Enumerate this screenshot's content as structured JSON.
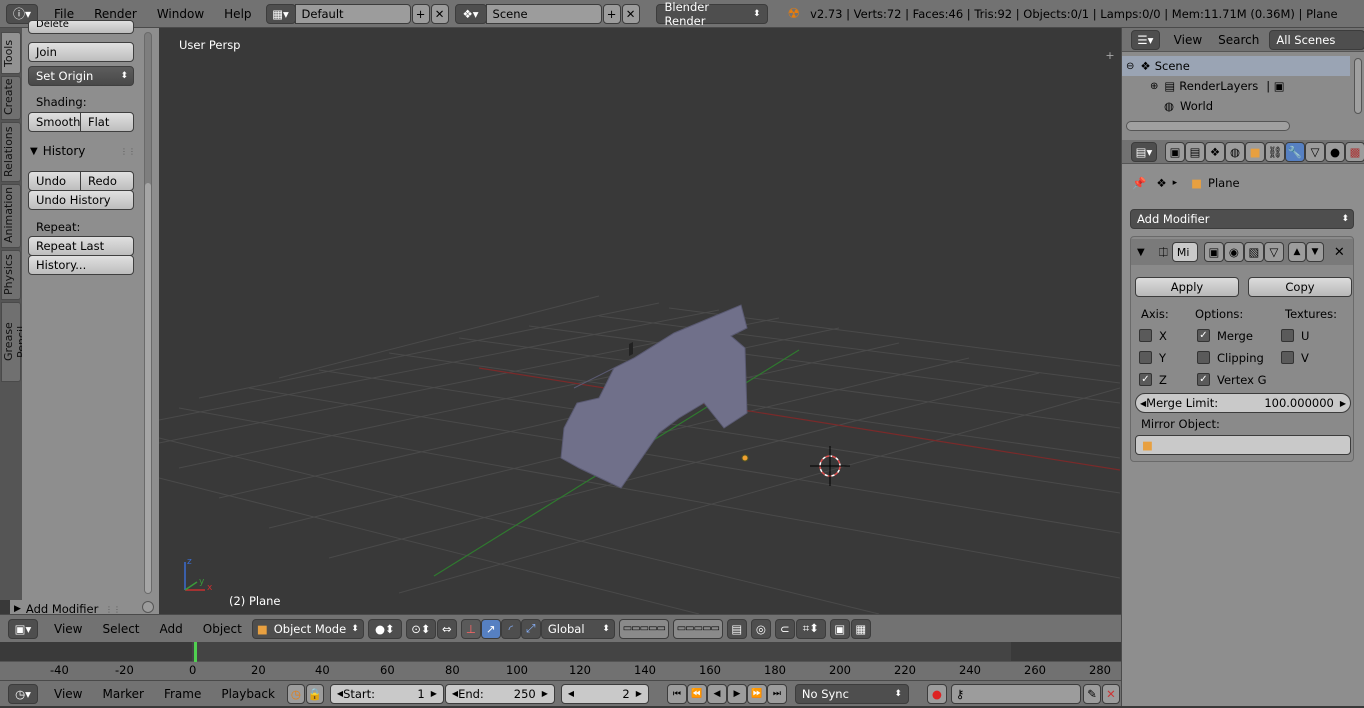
{
  "topbar": {
    "menus": [
      "File",
      "Render",
      "Window",
      "Help"
    ],
    "layout": "Default",
    "scene": "Scene",
    "engine": "Blender Render",
    "stats": "v2.73 | Verts:72 | Faces:46 | Tris:92 | Objects:0/1 | Lamps:0/0 | Mem:11.71M (0.36M) | Plane"
  },
  "tabs": [
    "Tools",
    "Create",
    "Relations",
    "Animation",
    "Physics",
    "Grease Pencil"
  ],
  "shelf": {
    "delete_label": "Delete",
    "join_label": "Join",
    "set_origin_label": "Set Origin",
    "shading_label": "Shading:",
    "smooth_label": "Smooth",
    "flat_label": "Flat",
    "history_title": "History",
    "undo_label": "Undo",
    "redo_label": "Redo",
    "undo_history_label": "Undo History",
    "repeat_label": "Repeat:",
    "repeat_last_label": "Repeat Last",
    "history_btn_label": "History...",
    "add_modifier_label": "Add Modifier"
  },
  "viewport": {
    "view_name": "User Persp",
    "object_label": "(2) Plane"
  },
  "vbar": {
    "menus": [
      "View",
      "Select",
      "Add",
      "Object"
    ],
    "mode": "Object Mode",
    "orientation": "Global"
  },
  "timeline": {
    "ticks": [
      "-40",
      "-20",
      "0",
      "20",
      "40",
      "60",
      "80",
      "100",
      "120",
      "140",
      "160",
      "180",
      "200",
      "220",
      "240",
      "260",
      "280"
    ]
  },
  "tlbar": {
    "menus": [
      "View",
      "Marker",
      "Frame",
      "Playback"
    ],
    "start_label": "Start:",
    "start_value": "1",
    "end_label": "End:",
    "end_value": "250",
    "current_frame": "2",
    "sync": "No Sync"
  },
  "outliner": {
    "view": "View",
    "search": "Search",
    "scenes": "All Scenes",
    "items": [
      "Scene",
      "RenderLayers",
      "World"
    ]
  },
  "props": {
    "breadcrumb": "Plane",
    "add_modifier": "Add Modifier",
    "modifier_name": "Mi",
    "apply": "Apply",
    "copy": "Copy",
    "axis_label": "Axis:",
    "options_label": "Options:",
    "textures_label": "Textures:",
    "x": "X",
    "y": "Y",
    "z": "Z",
    "merge": "Merge",
    "clipping": "Clipping",
    "vertex_groups": "Vertex G",
    "u": "U",
    "v": "V",
    "merge_limit_label": "Merge Limit:",
    "merge_limit_value": "100.000000",
    "mirror_object_label": "Mirror Object:"
  }
}
